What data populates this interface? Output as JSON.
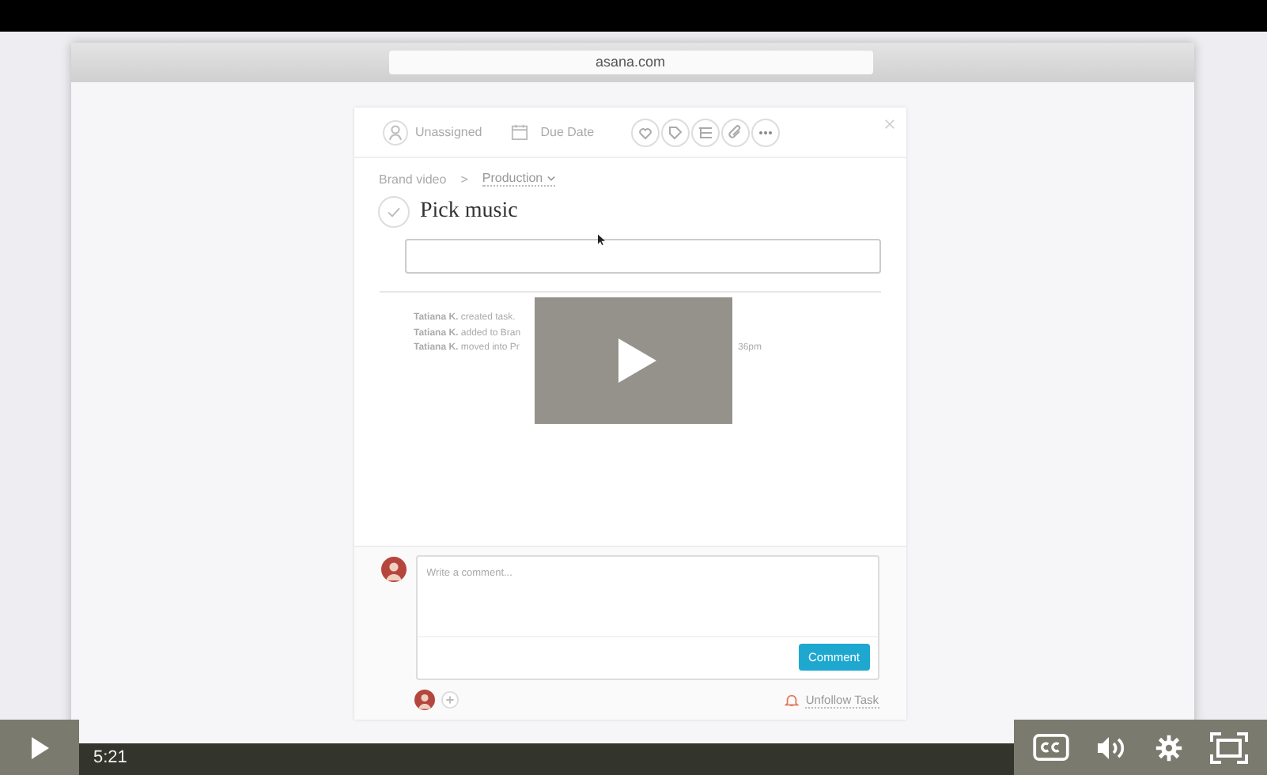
{
  "browser": {
    "url": "asana.com"
  },
  "task": {
    "assignee": "Unassigned",
    "due_date": "Due Date",
    "project": "Brand video",
    "separator": ">",
    "section": "Production",
    "completed": false,
    "title": "Pick music",
    "activity": [
      {
        "text": "**Tatiana K.** created task."
      },
      {
        "text": "**Tatiana K.** added to Bran"
      },
      {
        "text": "**Tatiana K.** moved into Pr",
        "tail": "36pm"
      }
    ]
  },
  "comment": {
    "placeholder": "Write a comment...",
    "button": "Comment",
    "unfollow": "Unfollow Task"
  },
  "player": {
    "time": "5:21",
    "level": 0
  }
}
